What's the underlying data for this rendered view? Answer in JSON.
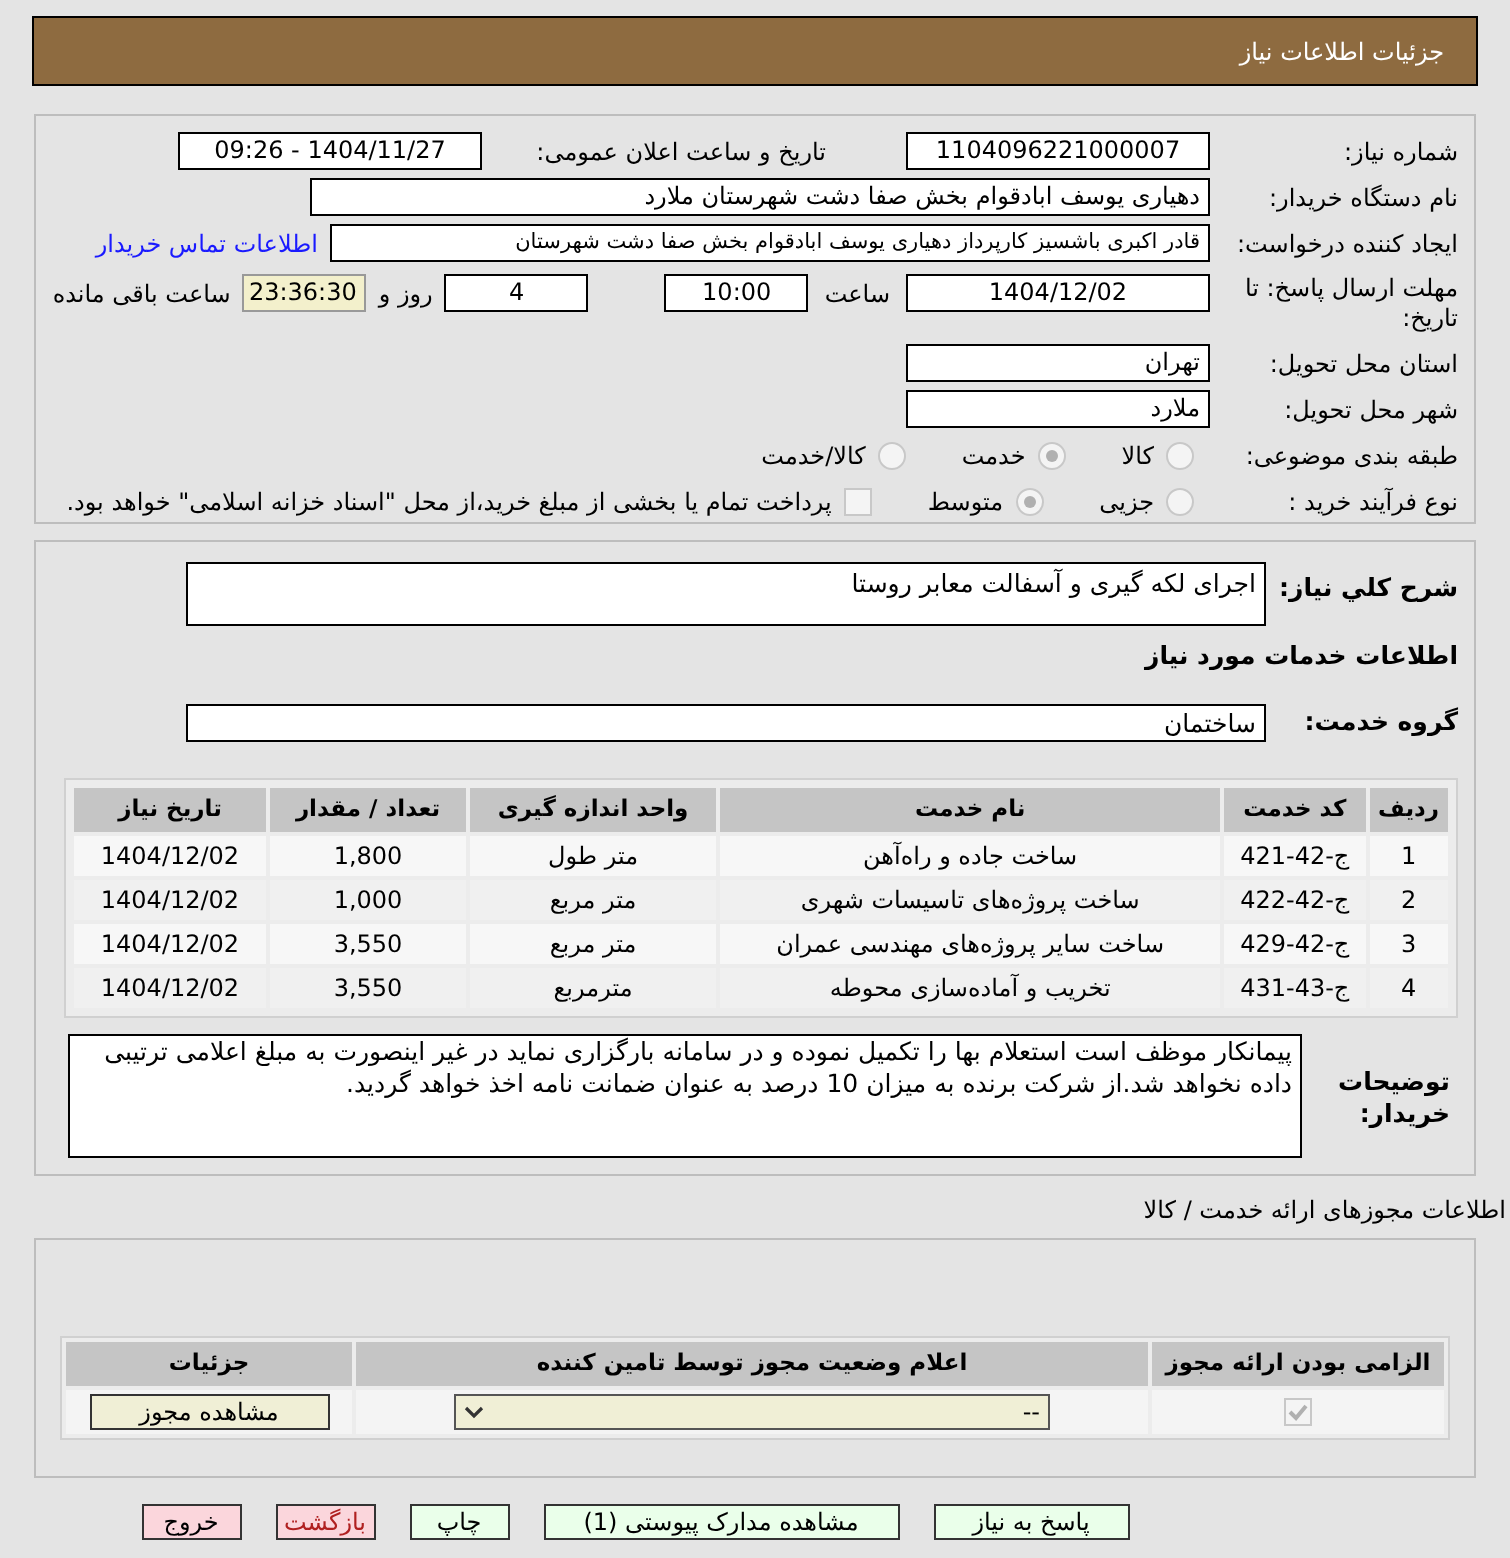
{
  "header": {
    "title": "جزئیات اطلاعات نیاز"
  },
  "need_number": {
    "label": "شماره نیاز:",
    "value": "1104096221000007"
  },
  "announce": {
    "label": "تاریخ و ساعت اعلان عمومی:",
    "value": "1404/11/27 - 09:26"
  },
  "buyer": {
    "label": "نام دستگاه خریدار:",
    "value": "دهیاری یوسف ابادقوام بخش صفا دشت شهرستان ملارد"
  },
  "creator": {
    "label": "ایجاد کننده درخواست:",
    "value": "قادر اکبری باشسیز کارپرداز دهیاری یوسف ابادقوام بخش صفا دشت شهرستان",
    "link": "اطلاعات تماس خریدار"
  },
  "deadline": {
    "label": "مهلت ارسال پاسخ: تا تاریخ:",
    "date": "1404/12/02",
    "time_label": "ساعت",
    "time": "10:00",
    "days": "4",
    "days_label": "روز و",
    "remaining": "23:36:30",
    "remaining_label": "ساعت باقی مانده"
  },
  "province": {
    "label": "استان محل تحویل:",
    "value": "تهران"
  },
  "city": {
    "label": "شهر محل تحویل:",
    "value": "ملارد"
  },
  "category": {
    "label": "طبقه بندی موضوعی:",
    "options": [
      {
        "label": "کالا",
        "selected": false
      },
      {
        "label": "خدمت",
        "selected": true
      },
      {
        "label": "کالا/خدمت",
        "selected": false
      }
    ]
  },
  "process": {
    "label": "نوع فرآیند خرید :",
    "options": [
      {
        "label": "جزیی",
        "selected": false
      },
      {
        "label": "متوسط",
        "selected": true
      }
    ],
    "payment_checkbox": {
      "checked": false,
      "label": "پرداخت تمام یا بخشی از مبلغ خرید،از محل \"اسناد خزانه اسلامی\" خواهد بود."
    }
  },
  "description": {
    "label": "شرح كلي نياز:",
    "value": "اجرای لکه گیری و آسفالت معابر روستا"
  },
  "services_title": "اطلاعات خدمات مورد نیاز",
  "service_group": {
    "label": "گروه خدمت:",
    "value": "ساختمان"
  },
  "table": {
    "columns": [
      "ردیف",
      "کد خدمت",
      "نام خدمت",
      "واحد اندازه گیری",
      "تعداد / مقدار",
      "تاریخ نیاز"
    ],
    "rows": [
      [
        "1",
        "ج-42-421",
        "ساخت جاده و راه‌آهن",
        "متر طول",
        "1,800",
        "1404/12/02"
      ],
      [
        "2",
        "ج-42-422",
        "ساخت پروژه‌های تاسیسات شهری",
        "متر مربع",
        "1,000",
        "1404/12/02"
      ],
      [
        "3",
        "ج-42-429",
        "ساخت سایر پروژه‌های مهندسی عمران",
        "متر مربع",
        "3,550",
        "1404/12/02"
      ],
      [
        "4",
        "ج-43-431",
        "تخریب و آماده‌سازی محوطه",
        "مترمربع",
        "3,550",
        "1404/12/02"
      ]
    ]
  },
  "buyer_notes": {
    "label": "توضیحات خریدار:",
    "value": "پیمانکار موظف است استعلام بها را تکمیل نموده و در سامانه بارگزاری نماید در غیر اینصورت به مبلغ اعلامی ترتیبی داده نخواهد شد.از شرکت برنده به میزان 10 درصد به عنوان ضمانت نامه اخذ خواهد گردید."
  },
  "licenses": {
    "title": "اطلاعات مجوزهای ارائه خدمت / کالا",
    "columns": [
      "الزامی بودن ارائه مجوز",
      "اعلام وضعیت مجوز توسط تامین کننده",
      "جزئیات"
    ],
    "row": {
      "required": true,
      "status": "--",
      "button": "مشاهده مجوز"
    }
  },
  "buttons": [
    {
      "label": "پاسخ به نیاز",
      "kind": "normal"
    },
    {
      "label": "مشاهده مدارک پیوستی (1)",
      "kind": "normal"
    },
    {
      "label": "چاپ",
      "kind": "normal"
    },
    {
      "label": "بازگشت",
      "kind": "back"
    },
    {
      "label": "خروج",
      "kind": "exit"
    }
  ]
}
